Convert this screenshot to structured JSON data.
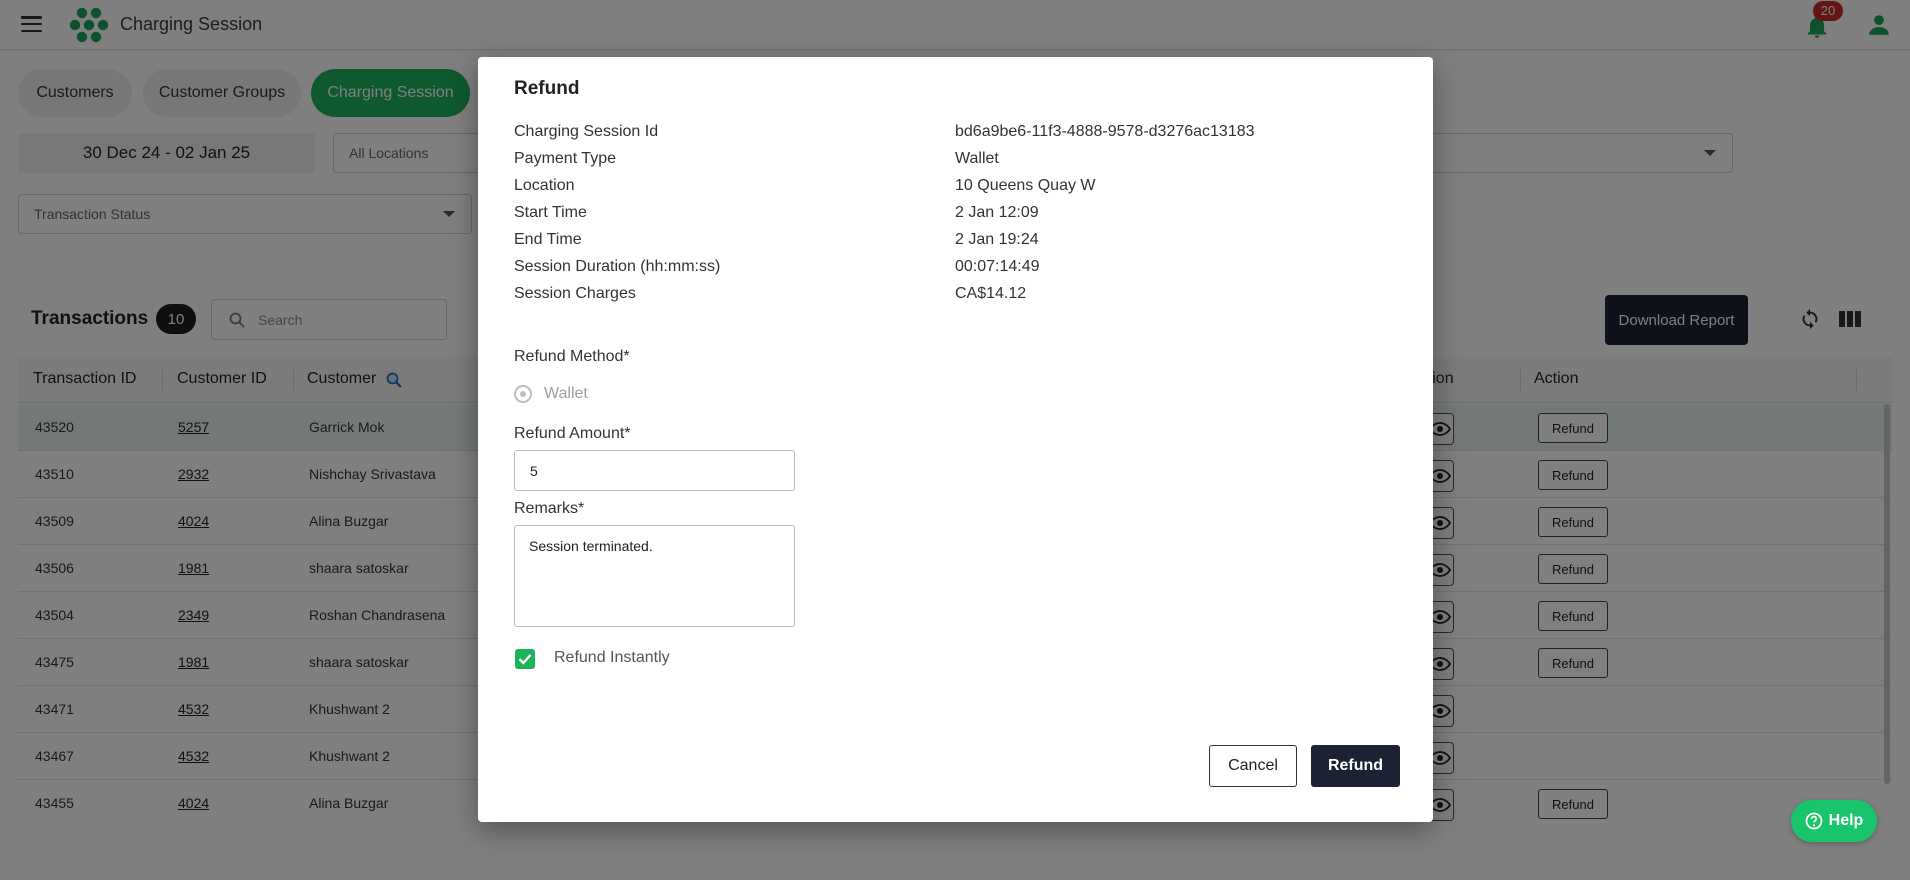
{
  "app": {
    "title": "Charging Session",
    "notification_count": "20"
  },
  "tabs": [
    {
      "label": "Customers",
      "active": false
    },
    {
      "label": "Customer Groups",
      "active": false
    },
    {
      "label": "Charging Session",
      "active": true
    }
  ],
  "filters": {
    "date_range": "30 Dec 24 - 02 Jan 25",
    "location_placeholder": "All Locations",
    "transaction_status_placeholder": "Transaction Status"
  },
  "transactions": {
    "title": "Transactions",
    "count": "10",
    "search_placeholder": "Search",
    "download_label": "Download Report",
    "columns": {
      "transaction_id": "Transaction ID",
      "customer_id": "Customer ID",
      "customer": "Customer",
      "destination_partial": "nation",
      "action": "Action"
    },
    "action_button_label": "Refund",
    "rows": [
      {
        "transaction_id": "43520",
        "customer_id": "5257",
        "customer": "Garrick Mok"
      },
      {
        "transaction_id": "43510",
        "customer_id": "2932",
        "customer": "Nishchay Srivastava"
      },
      {
        "transaction_id": "43509",
        "customer_id": "4024",
        "customer": "Alina Buzgar"
      },
      {
        "transaction_id": "43506",
        "customer_id": "1981",
        "customer": "shaara satoskar"
      },
      {
        "transaction_id": "43504",
        "customer_id": "2349",
        "customer": "Roshan Chandrasena"
      },
      {
        "transaction_id": "43475",
        "customer_id": "1981",
        "customer": "shaara satoskar"
      },
      {
        "transaction_id": "43471",
        "customer_id": "4532",
        "customer": "Khushwant 2"
      },
      {
        "transaction_id": "43467",
        "customer_id": "4532",
        "customer": "Khushwant 2"
      },
      {
        "transaction_id": "43455",
        "customer_id": "4024",
        "customer": "Alina Buzgar"
      }
    ]
  },
  "modal": {
    "title": "Refund",
    "details": [
      {
        "label": "Charging Session Id",
        "value": "bd6a9be6-11f3-4888-9578-d3276ac13183"
      },
      {
        "label": "Payment Type",
        "value": "Wallet"
      },
      {
        "label": "Location",
        "value": "10 Queens Quay W"
      },
      {
        "label": "Start Time",
        "value": "2 Jan 12:09"
      },
      {
        "label": "End Time",
        "value": "2 Jan 19:24"
      },
      {
        "label": "Session Duration (hh:mm:ss)",
        "value": "00:07:14:49"
      },
      {
        "label": "Session Charges",
        "value": "CA$14.12"
      }
    ],
    "refund_method_label": "Refund Method*",
    "refund_method_option": "Wallet",
    "refund_amount_label": "Refund Amount*",
    "refund_amount_value": "5",
    "remarks_label": "Remarks*",
    "remarks_value": "Session terminated.",
    "refund_instantly_label": "Refund Instantly",
    "refund_instantly_checked": true,
    "cancel_label": "Cancel",
    "submit_label": "Refund"
  },
  "help": {
    "label": "Help"
  },
  "colors": {
    "brand_green": "#1db35c",
    "dark_navy": "#1c2233",
    "badge_red": "#c62828",
    "help_green": "#19c56a",
    "row_highlight": "#e6f5ea"
  }
}
